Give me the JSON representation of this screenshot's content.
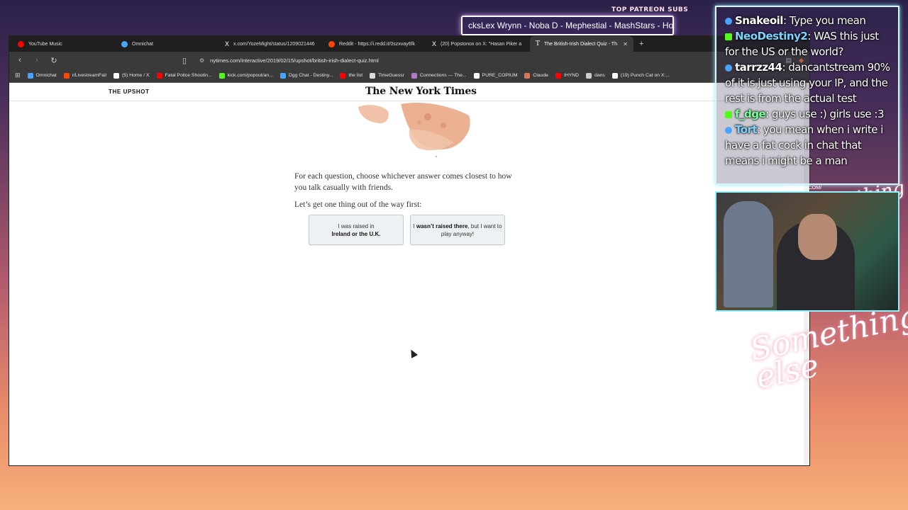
{
  "overlay": {
    "patreon_label": "TOP PATREON SUBS",
    "ticker_text": "cksLex Wrynn -  Noba D - Mephestial - MashStars - Hones",
    "signature": "Something else",
    "signature_small": "Anything else",
    "patreon_url": "PATREON.COM/"
  },
  "browser": {
    "tabs": [
      {
        "label": "YouTube Music",
        "color": "#ff0000"
      },
      {
        "label": "Omnichat",
        "color": "#4aa3ff"
      },
      {
        "label": "x.com/YozeMight/status/1209021446",
        "color": "#ffffff"
      },
      {
        "label": "Reddit - https://i.redd.it/0szxvay6fk",
        "color": "#ff4500"
      },
      {
        "label": "(20) Popstonox on X: \"Hasan Piker a",
        "color": "#ffffff"
      },
      {
        "label": "The British-Irish Dialect Quiz - Th",
        "color": "#ffffff",
        "active": true
      }
    ],
    "new_tab": "+",
    "url": "nytimes.com/interactive/2019/02/15/upshot/british-irish-dialect-quiz.html",
    "bookmarks": [
      {
        "label": "Omnichat",
        "color": "#4aa3ff"
      },
      {
        "label": "r/LivestreamFail",
        "color": "#ff4500"
      },
      {
        "label": "(5) Home / X",
        "color": "#ffffff"
      },
      {
        "label": "Fatal Police Shootin...",
        "color": "#ff0000"
      },
      {
        "label": "kick.com/popout/an...",
        "color": "#53fc18"
      },
      {
        "label": "Dgg Chat - Destiny...",
        "color": "#4aa3ff"
      },
      {
        "label": "the list",
        "color": "#ff0000"
      },
      {
        "label": "TimeGuessr",
        "color": "#dddddd"
      },
      {
        "label": "Connections — The...",
        "color": "#b07cc6"
      },
      {
        "label": "PURE_COPIUM",
        "color": "#ffffff"
      },
      {
        "label": "Claude",
        "color": "#d97757"
      },
      {
        "label": "IHYND",
        "color": "#ff0000"
      },
      {
        "label": "dans",
        "color": "#cccccc"
      },
      {
        "label": "(19) Punch Cat on X:...",
        "color": "#ffffff"
      }
    ]
  },
  "page": {
    "section": "THE UPSHOT",
    "masthead": "The New York Times",
    "intro_1": "For each question, choose whichever answer comes closest to how you talk casually with friends.",
    "intro_2": "Let’s get one thing out of the way first:",
    "choice_a_pre": "I was raised in",
    "choice_a_bold": "Ireland or the U.K.",
    "choice_b_bold": "wasn’t raised there",
    "choice_b_pre": "I",
    "choice_b_post": ", but I want to play anyway!"
  },
  "chat": [
    {
      "user": "Snakeoil",
      "text": ": Type you mean",
      "badge": "#4aa3ff",
      "user_color": "#ffffff"
    },
    {
      "user": "NeoDestiny2",
      "text": ": WAS this just for the US or the world?",
      "badge": "#53fc18",
      "user_color": "#7fd3ff"
    },
    {
      "user": "tarrzz44",
      "text": ": dancantstream 90% of it is just using your IP, and the rest is from the actual test",
      "badge": "#4aa3ff",
      "user_color": "#ffffff"
    },
    {
      "user": "f_dge",
      "text": ": guys use :) girls use :3",
      "badge": "#53fc18",
      "user_color": "#7dff9a"
    },
    {
      "user": "Tort",
      "text": ": you mean when i write i have a fat cock in chat that means i might be a man",
      "badge": "#4aa3ff",
      "user_color": "#7fd3ff"
    }
  ]
}
